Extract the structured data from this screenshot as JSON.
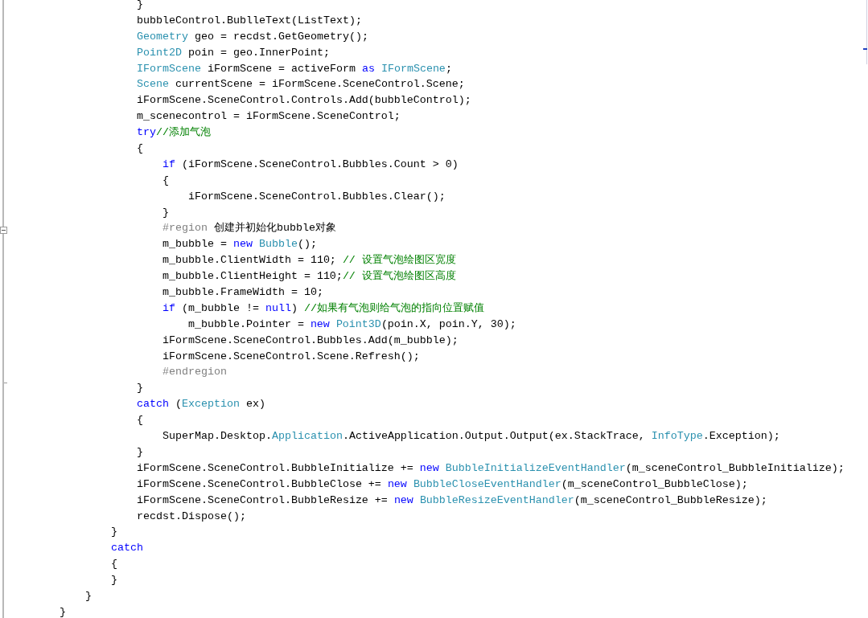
{
  "code": [
    {
      "kind": "block",
      "children": [
        {
          "kind": "block",
          "children": [
            {
              "kind": "block",
              "children": [
                {
                  "kind": "line",
                  "tokens": [
                    {
                      "kind": "plain",
                      "text": "}"
                    }
                  ]
                },
                {
                  "kind": "line",
                  "tokens": [
                    {
                      "kind": "plain",
                      "text": "bubbleControl.BublleText(ListText);"
                    }
                  ]
                },
                {
                  "kind": "line",
                  "tokens": [
                    {
                      "kind": "type",
                      "text": "Geometry"
                    },
                    {
                      "kind": "plain",
                      "text": " geo = recdst.GetGeometry();"
                    }
                  ]
                },
                {
                  "kind": "line",
                  "tokens": [
                    {
                      "kind": "type",
                      "text": "Point2D"
                    },
                    {
                      "kind": "plain",
                      "text": " poin = geo.InnerPoint;"
                    }
                  ]
                },
                {
                  "kind": "line",
                  "tokens": [
                    {
                      "kind": "type",
                      "text": "IFormScene"
                    },
                    {
                      "kind": "plain",
                      "text": " iFormScene = activeForm "
                    },
                    {
                      "kind": "keyword",
                      "text": "as "
                    },
                    {
                      "kind": "type",
                      "text": "IFormScene"
                    },
                    {
                      "kind": "plain",
                      "text": ";"
                    }
                  ]
                },
                {
                  "kind": "line",
                  "tokens": [
                    {
                      "kind": "type",
                      "text": "Scene"
                    },
                    {
                      "kind": "plain",
                      "text": " currentScene = iFormScene.SceneControl.Scene;"
                    }
                  ]
                },
                {
                  "kind": "line",
                  "tokens": [
                    {
                      "kind": "plain",
                      "text": "iFormScene.SceneControl.Controls.Add(bubbleControl);"
                    }
                  ]
                },
                {
                  "kind": "line",
                  "tokens": [
                    {
                      "kind": "plain",
                      "text": "m_scenecontrol = iFormScene.SceneControl;"
                    }
                  ]
                },
                {
                  "kind": "line",
                  "tokens": [
                    {
                      "kind": "keyword",
                      "text": "try"
                    },
                    {
                      "kind": "comment",
                      "text": "//添加气泡"
                    }
                  ]
                },
                {
                  "kind": "line",
                  "tokens": [
                    {
                      "kind": "plain",
                      "text": "{"
                    }
                  ]
                },
                {
                  "kind": "block",
                  "children": [
                    {
                      "kind": "line",
                      "tokens": [
                        {
                          "kind": "keyword",
                          "text": "if"
                        },
                        {
                          "kind": "plain",
                          "text": " (iFormScene.SceneControl.Bubbles.Count > 0)"
                        }
                      ]
                    },
                    {
                      "kind": "line",
                      "tokens": [
                        {
                          "kind": "plain",
                          "text": "{"
                        }
                      ]
                    },
                    {
                      "kind": "block",
                      "children": [
                        {
                          "kind": "line",
                          "tokens": [
                            {
                              "kind": "plain",
                              "text": "iFormScene.SceneControl.Bubbles.Clear();"
                            }
                          ]
                        }
                      ]
                    },
                    {
                      "kind": "line",
                      "tokens": [
                        {
                          "kind": "plain",
                          "text": "}"
                        }
                      ]
                    },
                    {
                      "kind": "line",
                      "tokens": [
                        {
                          "kind": "directive",
                          "text": "#region"
                        },
                        {
                          "kind": "plain",
                          "text": " 创建并初始化bubble对象"
                        }
                      ]
                    },
                    {
                      "kind": "line",
                      "tokens": [
                        {
                          "kind": "plain",
                          "text": "m_bubble = "
                        },
                        {
                          "kind": "keyword",
                          "text": "new "
                        },
                        {
                          "kind": "type",
                          "text": "Bubble"
                        },
                        {
                          "kind": "plain",
                          "text": "();"
                        }
                      ]
                    },
                    {
                      "kind": "line",
                      "tokens": [
                        {
                          "kind": "plain",
                          "text": "m_bubble.ClientWidth = 110; "
                        },
                        {
                          "kind": "comment",
                          "text": "// 设置气泡绘图区宽度"
                        }
                      ]
                    },
                    {
                      "kind": "line",
                      "tokens": [
                        {
                          "kind": "plain",
                          "text": "m_bubble.ClientHeight = 110;"
                        },
                        {
                          "kind": "comment",
                          "text": "// 设置气泡绘图区高度"
                        }
                      ]
                    },
                    {
                      "kind": "line",
                      "tokens": [
                        {
                          "kind": "plain",
                          "text": "m_bubble.FrameWidth = 10;"
                        }
                      ]
                    },
                    {
                      "kind": "line",
                      "tokens": [
                        {
                          "kind": "keyword",
                          "text": "if"
                        },
                        {
                          "kind": "plain",
                          "text": " (m_bubble != "
                        },
                        {
                          "kind": "keyword",
                          "text": "null"
                        },
                        {
                          "kind": "plain",
                          "text": ") "
                        },
                        {
                          "kind": "comment",
                          "text": "//如果有气泡则给气泡的指向位置赋值"
                        }
                      ]
                    },
                    {
                      "kind": "block",
                      "children": [
                        {
                          "kind": "line",
                          "tokens": [
                            {
                              "kind": "plain",
                              "text": "m_bubble.Pointer = "
                            },
                            {
                              "kind": "keyword",
                              "text": "new "
                            },
                            {
                              "kind": "type",
                              "text": "Point3D"
                            },
                            {
                              "kind": "plain",
                              "text": "(poin.X, poin.Y, 30);"
                            }
                          ]
                        }
                      ]
                    },
                    {
                      "kind": "line",
                      "tokens": [
                        {
                          "kind": "plain",
                          "text": "iFormScene.SceneControl.Bubbles.Add(m_bubble);"
                        }
                      ]
                    },
                    {
                      "kind": "line",
                      "tokens": [
                        {
                          "kind": "plain",
                          "text": "iFormScene.SceneControl.Scene.Refresh();"
                        }
                      ]
                    },
                    {
                      "kind": "line",
                      "tokens": [
                        {
                          "kind": "directive",
                          "text": "#endregion"
                        }
                      ]
                    }
                  ]
                },
                {
                  "kind": "line",
                  "tokens": [
                    {
                      "kind": "plain",
                      "text": "}"
                    }
                  ]
                },
                {
                  "kind": "line",
                  "tokens": [
                    {
                      "kind": "keyword",
                      "text": "catch"
                    },
                    {
                      "kind": "plain",
                      "text": " ("
                    },
                    {
                      "kind": "type",
                      "text": "Exception"
                    },
                    {
                      "kind": "plain",
                      "text": " ex)"
                    }
                  ]
                },
                {
                  "kind": "line",
                  "tokens": [
                    {
                      "kind": "plain",
                      "text": "{"
                    }
                  ]
                },
                {
                  "kind": "block",
                  "children": [
                    {
                      "kind": "line",
                      "tokens": [
                        {
                          "kind": "plain",
                          "text": "SuperMap.Desktop."
                        },
                        {
                          "kind": "type",
                          "text": "Application"
                        },
                        {
                          "kind": "plain",
                          "text": ".ActiveApplication.Output.Output(ex.StackTrace, "
                        },
                        {
                          "kind": "type",
                          "text": "InfoType"
                        },
                        {
                          "kind": "plain",
                          "text": ".Exception);"
                        }
                      ]
                    }
                  ]
                },
                {
                  "kind": "line",
                  "tokens": [
                    {
                      "kind": "plain",
                      "text": "}"
                    }
                  ]
                },
                {
                  "kind": "line",
                  "tokens": [
                    {
                      "kind": "plain",
                      "text": "iFormScene.SceneControl.BubbleInitialize += "
                    },
                    {
                      "kind": "keyword",
                      "text": "new "
                    },
                    {
                      "kind": "type",
                      "text": "BubbleInitializeEventHandler"
                    },
                    {
                      "kind": "plain",
                      "text": "(m_sceneControl_BubbleInitialize);"
                    }
                  ]
                },
                {
                  "kind": "line",
                  "tokens": [
                    {
                      "kind": "plain",
                      "text": "iFormScene.SceneControl.BubbleClose += "
                    },
                    {
                      "kind": "keyword",
                      "text": "new "
                    },
                    {
                      "kind": "type",
                      "text": "BubbleCloseEventHandler"
                    },
                    {
                      "kind": "plain",
                      "text": "(m_sceneControl_BubbleClose);"
                    }
                  ]
                },
                {
                  "kind": "line",
                  "tokens": [
                    {
                      "kind": "plain",
                      "text": "iFormScene.SceneControl.BubbleResize += "
                    },
                    {
                      "kind": "keyword",
                      "text": "new "
                    },
                    {
                      "kind": "type",
                      "text": "BubbleResizeEventHandler"
                    },
                    {
                      "kind": "plain",
                      "text": "(m_sceneControl_BubbleResize);"
                    }
                  ]
                },
                {
                  "kind": "line",
                  "tokens": [
                    {
                      "kind": "plain",
                      "text": "recdst.Dispose();"
                    }
                  ]
                }
              ]
            },
            {
              "kind": "line",
              "tokens": [
                {
                  "kind": "plain",
                  "text": "}"
                }
              ]
            },
            {
              "kind": "line",
              "tokens": [
                {
                  "kind": "keyword",
                  "text": "catch"
                }
              ]
            },
            {
              "kind": "line",
              "tokens": [
                {
                  "kind": "plain",
                  "text": "{"
                }
              ]
            },
            {
              "kind": "line",
              "tokens": [
                {
                  "kind": "plain",
                  "text": "}"
                }
              ]
            }
          ]
        },
        {
          "kind": "line",
          "tokens": [
            {
              "kind": "plain",
              "text": "}"
            }
          ]
        }
      ]
    },
    {
      "kind": "line",
      "tokens": [
        {
          "kind": "plain",
          "text": "}"
        }
      ]
    }
  ]
}
